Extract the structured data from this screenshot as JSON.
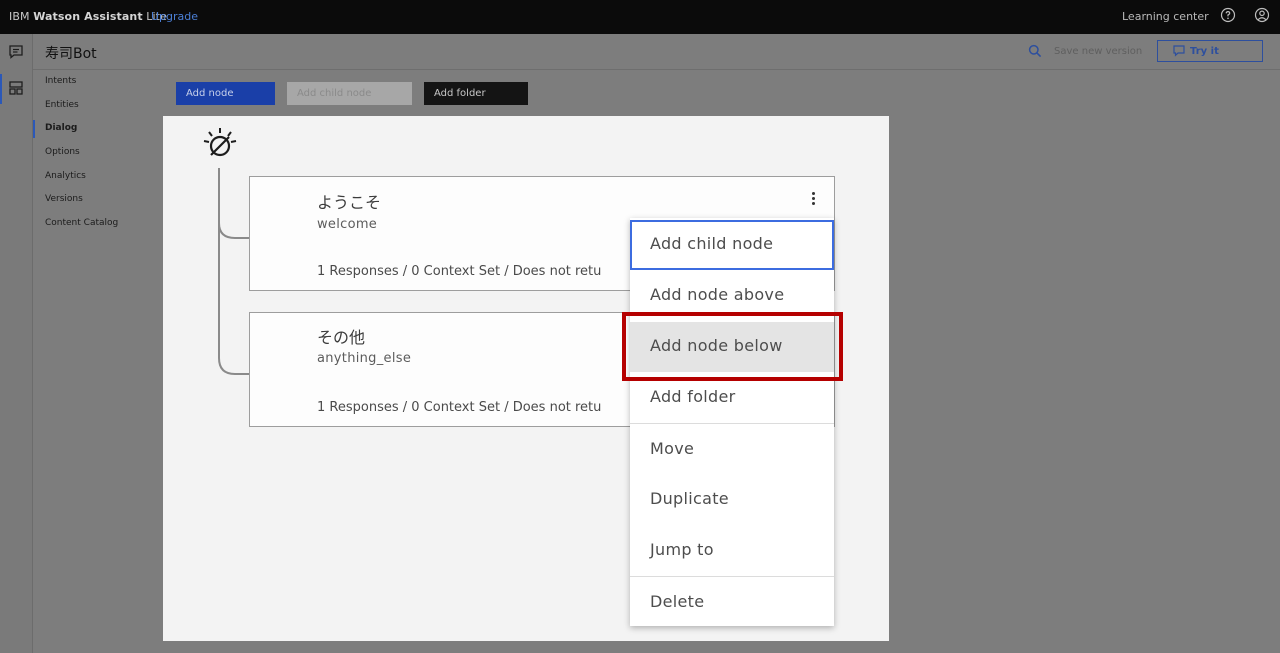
{
  "topbar": {
    "brand_prefix": "IBM ",
    "brand_bold": "Watson Assistant",
    "brand_suffix": " Lite",
    "upgrade": "Upgrade",
    "learning_center": "Learning center"
  },
  "header": {
    "bot_title": "寿司Bot",
    "save_version": "Save new version",
    "try_it": "Try it"
  },
  "nav": {
    "items": [
      {
        "label": "Intents"
      },
      {
        "label": "Entities"
      },
      {
        "label": "Dialog"
      },
      {
        "label": "Options"
      },
      {
        "label": "Analytics"
      },
      {
        "label": "Versions"
      },
      {
        "label": "Content Catalog"
      }
    ],
    "active": "Dialog"
  },
  "actions": {
    "add_node": "Add node",
    "add_child_node": "Add child node",
    "add_folder": "Add folder"
  },
  "nodes": [
    {
      "title": "ようこそ",
      "condition": "welcome",
      "summary": "1 Responses / 0 Context Set / Does not retu"
    },
    {
      "title": "その他",
      "condition": "anything_else",
      "summary": "1 Responses / 0 Context Set / Does not retu"
    }
  ],
  "menu": {
    "items": [
      {
        "label": "Add child node"
      },
      {
        "label": "Add node above"
      },
      {
        "label": "Add node below"
      },
      {
        "label": "Add folder"
      },
      {
        "label": "Move"
      },
      {
        "label": "Duplicate"
      },
      {
        "label": "Jump to"
      },
      {
        "label": "Delete"
      }
    ],
    "focused": "Add child node",
    "highlighted": "Add node below"
  },
  "colors": {
    "accent": "#1a3fa8",
    "highlight": "#b50000",
    "focus": "#3c6ce0"
  }
}
